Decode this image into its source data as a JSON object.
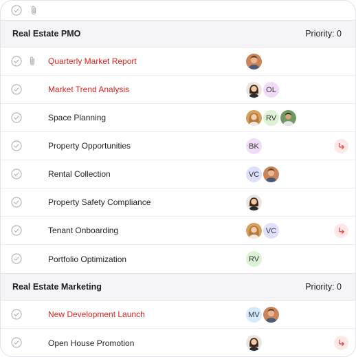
{
  "toolbar": {
    "icons": [
      "check-circle-icon",
      "paperclip-icon"
    ]
  },
  "colors": {
    "overdue": "#e0201f",
    "subtask_bg": "#fde7e7",
    "subtask_fg": "#e53935"
  },
  "groups": [
    {
      "title": "Real Estate PMO",
      "priority": "Priority: 0",
      "tasks": [
        {
          "name": "Quarterly Market Report",
          "overdue": true,
          "attachment": true,
          "assignees": [
            {
              "type": "photo",
              "variant": "man-brown"
            }
          ]
        },
        {
          "name": "Market Trend Analysis",
          "overdue": true,
          "assignees": [
            {
              "type": "photo",
              "variant": "woman-dark"
            },
            {
              "type": "initials",
              "text": "OL",
              "color": "#f0dcf7"
            }
          ]
        },
        {
          "name": "Space Planning",
          "assignees": [
            {
              "type": "photo",
              "variant": "woman-blonde"
            },
            {
              "type": "initials",
              "text": "RV",
              "color": "#dcf2d4"
            },
            {
              "type": "photo",
              "variant": "man-green"
            }
          ]
        },
        {
          "name": "Property Opportunities",
          "subtask": true,
          "assignees": [
            {
              "type": "initials",
              "text": "BK",
              "color": "#f0dcf7"
            }
          ]
        },
        {
          "name": "Rental Collection",
          "assignees": [
            {
              "type": "initials",
              "text": "VC",
              "color": "#dfe0fb"
            },
            {
              "type": "photo",
              "variant": "man-brown"
            }
          ]
        },
        {
          "name": "Property Safety Compliance",
          "assignees": [
            {
              "type": "photo",
              "variant": "woman-dark"
            }
          ]
        },
        {
          "name": "Tenant Onboarding",
          "subtask": true,
          "assignees": [
            {
              "type": "photo",
              "variant": "woman-blonde"
            },
            {
              "type": "initials",
              "text": "VC",
              "color": "#dfe0fb"
            }
          ]
        },
        {
          "name": "Portfolio Optimization",
          "assignees": [
            {
              "type": "initials",
              "text": "RV",
              "color": "#dcf2d4"
            }
          ]
        }
      ]
    },
    {
      "title": "Real Estate Marketing",
      "priority": "Priority: 0",
      "tasks": [
        {
          "name": "New Development Launch",
          "overdue": true,
          "assignees": [
            {
              "type": "initials",
              "text": "MV",
              "color": "#d5eafc"
            },
            {
              "type": "photo",
              "variant": "man-brown"
            }
          ]
        },
        {
          "name": "Open House Promotion",
          "subtask": true,
          "assignees": [
            {
              "type": "photo",
              "variant": "woman-dark"
            }
          ]
        }
      ]
    }
  ]
}
